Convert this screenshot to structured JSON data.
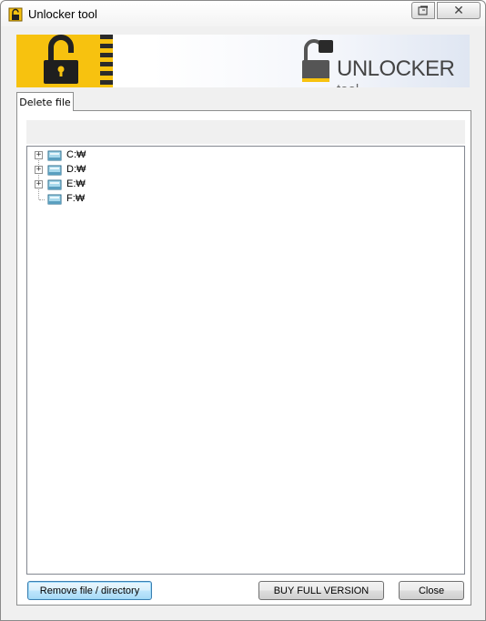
{
  "window": {
    "title": "Unlocker tool",
    "close_glyph": "✕",
    "restore_icon": "restore-window-icon"
  },
  "banner": {
    "logo_big": "UNLOCKER",
    "logo_small": "tool",
    "accent_color": "#f7c20f"
  },
  "tabs": [
    {
      "label": "Delete file",
      "selected": true
    }
  ],
  "tree": {
    "items": [
      {
        "label": "C:₩",
        "expandable": true,
        "expander": "+"
      },
      {
        "label": "D:₩",
        "expandable": true,
        "expander": "+"
      },
      {
        "label": "E:₩",
        "expandable": true,
        "expander": "+"
      },
      {
        "label": "F:₩",
        "expandable": false,
        "expander": ""
      }
    ]
  },
  "buttons": {
    "remove": "Remove file / directory",
    "buy": "BUY FULL VERSION",
    "close": "Close"
  }
}
